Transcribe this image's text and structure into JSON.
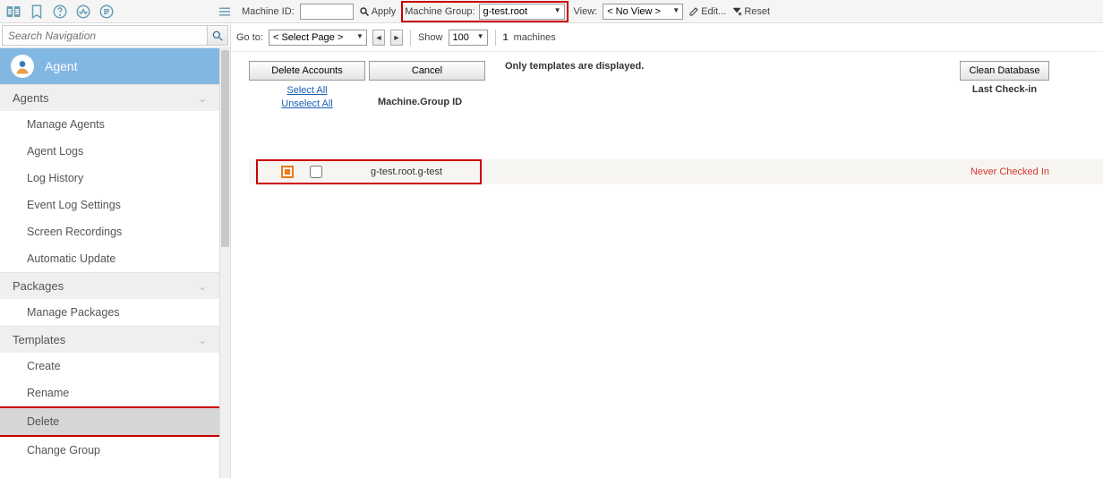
{
  "topbar": {
    "machine_id_label": "Machine ID:",
    "machine_id_value": "",
    "apply_label": "Apply",
    "machine_group_label": "Machine Group:",
    "machine_group_value": "g-test.root",
    "view_label": "View:",
    "view_value": "< No View >",
    "edit_label": "Edit...",
    "reset_label": "Reset"
  },
  "search": {
    "placeholder": "Search Navigation"
  },
  "module": {
    "title": "Agent"
  },
  "nav": {
    "sections": [
      {
        "label": "Agents",
        "items": [
          {
            "label": "Manage Agents"
          },
          {
            "label": "Agent Logs"
          },
          {
            "label": "Log History"
          },
          {
            "label": "Event Log Settings"
          },
          {
            "label": "Screen Recordings"
          },
          {
            "label": "Automatic Update"
          }
        ]
      },
      {
        "label": "Packages",
        "items": [
          {
            "label": "Manage Packages"
          }
        ]
      },
      {
        "label": "Templates",
        "items": [
          {
            "label": "Create"
          },
          {
            "label": "Rename"
          },
          {
            "label": "Delete",
            "active": true,
            "highlight": true
          },
          {
            "label": "Change Group"
          }
        ]
      }
    ]
  },
  "filter": {
    "goto_label": "Go to:",
    "goto_value": "< Select Page >",
    "show_label": "Show",
    "show_value": "100",
    "count_num": "1",
    "count_label": "machines"
  },
  "actions": {
    "delete_btn": "Delete Accounts",
    "cancel_btn": "Cancel",
    "select_all": "Select All",
    "unselect_all": "Unselect All",
    "col_machine": "Machine.Group ID",
    "note": "Only templates are displayed.",
    "clean_db": "Clean Database",
    "col_checkin": "Last Check-in"
  },
  "row": {
    "id": "g-test.root.g-test",
    "status": "Never Checked In"
  }
}
